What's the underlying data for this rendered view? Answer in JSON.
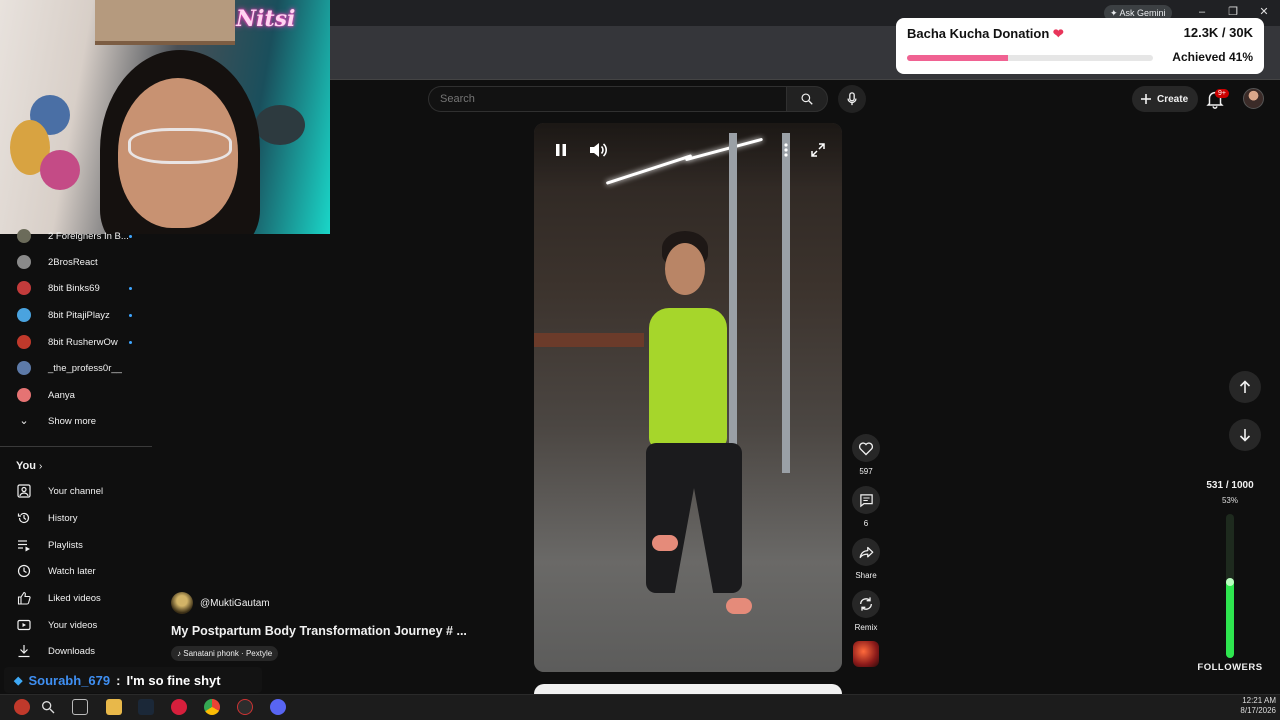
{
  "browser": {
    "ask_gemini": "Ask Gemini",
    "window_controls": [
      "–",
      "❐",
      "✕"
    ]
  },
  "webcam": {
    "logo": "Nitsi"
  },
  "donation": {
    "title": "Bacha Kucha Donation",
    "amount": "12.3K / 30K",
    "achieved": "Achieved 41%",
    "progress": 0.41,
    "bar_color": "#f06292"
  },
  "header": {
    "search_placeholder": "Search",
    "create_label": "Create",
    "notifications_badge": "9+"
  },
  "sidebar": {
    "subscriptions": [
      {
        "name": "2 Foreigners In B...",
        "dot": true,
        "color": "#6b6b5a"
      },
      {
        "name": "2BrosReact",
        "dot": false,
        "color": "#8a8a8a"
      },
      {
        "name": "8bit Binks69",
        "dot": true,
        "color": "#c23b3b"
      },
      {
        "name": "8bit PitajiPlayz",
        "dot": true,
        "color": "#4aa3df"
      },
      {
        "name": "8bit RusherwOw",
        "dot": true,
        "color": "#c0392b"
      },
      {
        "name": "_the_profess0r__",
        "dot": false,
        "color": "#5d7aa8"
      },
      {
        "name": "Aanya",
        "dot": false,
        "color": "#e57373"
      }
    ],
    "show_more": "Show more",
    "you_heading": "You",
    "you_items": [
      {
        "label": "Your channel",
        "icon": "user-icon"
      },
      {
        "label": "History",
        "icon": "history-icon"
      },
      {
        "label": "Playlists",
        "icon": "playlists-icon"
      },
      {
        "label": "Watch later",
        "icon": "clock-icon"
      },
      {
        "label": "Liked videos",
        "icon": "thumbs-up-icon"
      },
      {
        "label": "Your videos",
        "icon": "video-icon"
      },
      {
        "label": "Downloads",
        "icon": "download-icon"
      }
    ]
  },
  "short": {
    "channel": "@MuktiGautam",
    "title": "My Postpartum Body Transformation Journey # ...",
    "sound": "Sanatani phonk · Pextyle"
  },
  "actions": {
    "likes": "597",
    "comments": "6",
    "share": "Share",
    "remix": "Remix"
  },
  "followers": {
    "count": "531 / 1000",
    "percent": "53%",
    "progress": 0.53,
    "label": "FOLLOWERS",
    "bar_color": "#2ee64f"
  },
  "chat": {
    "user": "Sourabh_679",
    "separator": ":",
    "message": "I'm so fine shyt"
  },
  "taskbar": {
    "time": "12:21 AM",
    "date": "8/17/2026"
  }
}
